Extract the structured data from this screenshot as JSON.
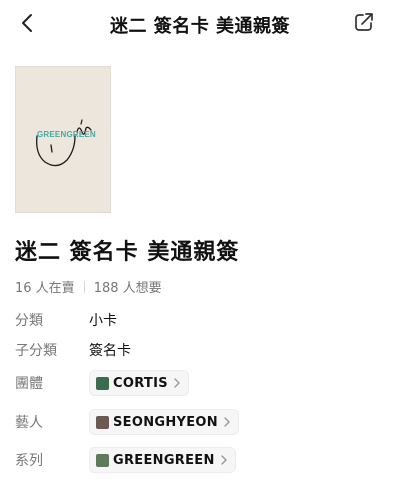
{
  "header": {
    "title": "迷二 簽名卡 美通親簽",
    "back_icon": "chevron-left-icon",
    "share_icon": "share-icon"
  },
  "item": {
    "watermark": "GREENGREEN",
    "title": "迷二 簽名卡 美通親簽",
    "stats": {
      "selling": "16 人在賣",
      "wanting": "188 人想要"
    }
  },
  "details": {
    "category": {
      "label": "分類",
      "value": "小卡"
    },
    "subcategory": {
      "label": "子分類",
      "value": "簽名卡"
    },
    "group": {
      "label": "團體",
      "value": "CORTIS"
    },
    "artist": {
      "label": "藝人",
      "value": "SEONGHYEON"
    },
    "series": {
      "label": "系列",
      "value": "GREENGREEN"
    }
  },
  "colors": {
    "watermark": "#4aa7a0",
    "card_bg": "#ece6dc",
    "muted_text": "#777777"
  }
}
